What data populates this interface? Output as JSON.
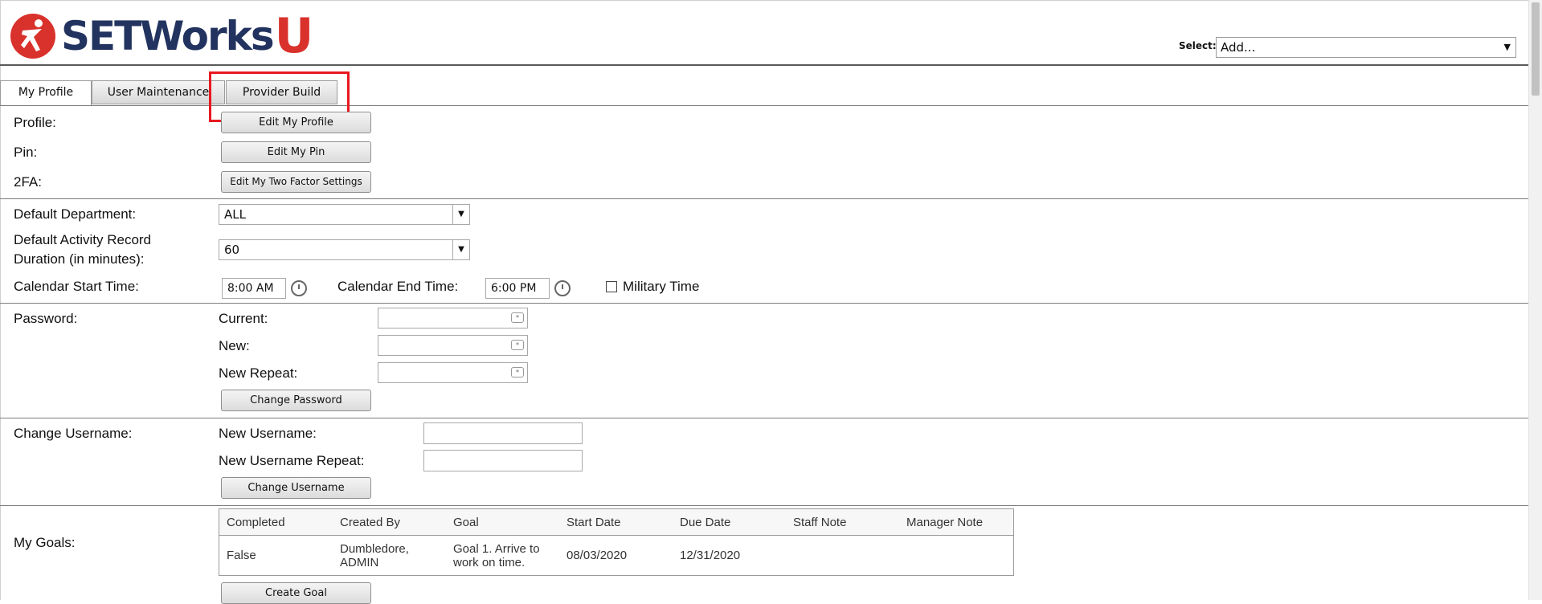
{
  "header": {
    "logo": "SETWorksU",
    "logo_main": "SETWorks",
    "logo_u": "U",
    "select_label": "Select:",
    "select_value": "Add..."
  },
  "tabs": [
    {
      "label": "My Profile",
      "active": true
    },
    {
      "label": "User Maintenance",
      "active": false
    },
    {
      "label": "Provider Build",
      "active": false
    }
  ],
  "profile": {
    "profile_label": "Profile:",
    "pin_label": "Pin:",
    "twofa_label": "2FA:",
    "edit_profile_button": "Edit My Profile",
    "edit_pin_button": "Edit My Pin",
    "edit_2fa_button": "Edit My Two Factor Settings"
  },
  "defaults": {
    "department_label": "Default Department:",
    "department_value": "ALL",
    "duration_label_line1": "Default Activity Record",
    "duration_label_line2": "Duration (in minutes):",
    "duration_value": "60",
    "calendar_start_label": "Calendar Start Time:",
    "calendar_start_value": "8:00 AM",
    "calendar_end_label": "Calendar End Time:",
    "calendar_end_value": "6:00 PM",
    "military_label": "Military Time",
    "military_checked": false
  },
  "password": {
    "section_label": "Password:",
    "current_label": "Current:",
    "new_label": "New:",
    "new_repeat_label": "New Repeat:",
    "change_button": "Change Password"
  },
  "username": {
    "section_label": "Change Username:",
    "new_label": "New Username:",
    "repeat_label": "New Username Repeat:",
    "change_button": "Change Username"
  },
  "goals": {
    "section_label": "My Goals:",
    "columns": [
      "Completed",
      "Created By",
      "Goal",
      "Start Date",
      "Due Date",
      "Staff Note",
      "Manager Note"
    ],
    "rows": [
      {
        "completed": "False",
        "created_by": "Dumbledore, ADMIN",
        "goal": "Goal 1. Arrive to work on time.",
        "start_date": "08/03/2020",
        "due_date": "12/31/2020",
        "staff_note": "",
        "manager_note": ""
      }
    ],
    "create_button": "Create Goal"
  },
  "colors": {
    "brand_navy": "#23335f",
    "brand_red": "#d9312b",
    "highlight": "#e8191f"
  }
}
